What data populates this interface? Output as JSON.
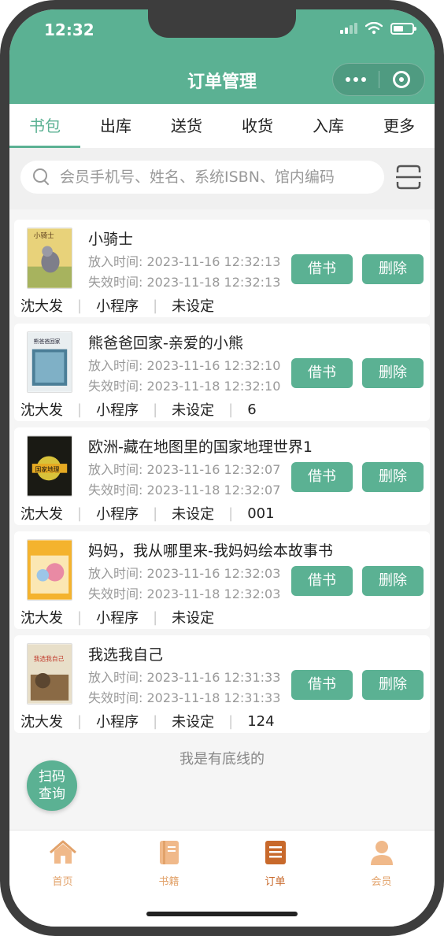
{
  "status": {
    "time": "12:32"
  },
  "header": {
    "title": "订单管理"
  },
  "tabs": [
    "书包",
    "出库",
    "送货",
    "收货",
    "入库",
    "更多"
  ],
  "search": {
    "placeholder": "会员手机号、姓名、系统ISBN、馆内编码"
  },
  "labels": {
    "borrow": "借书",
    "delete": "删除",
    "put_in_prefix": "放入时间: ",
    "expire_prefix": "失效时间: "
  },
  "orders": [
    {
      "title": "小骑士",
      "put_in": "放入时间: 2023-11-16 12:32:13",
      "expire": "失效时间: 2023-11-18 12:32:13",
      "member": "沈大发",
      "source": "小程序",
      "setting": "未设定",
      "extra": ""
    },
    {
      "title": "熊爸爸回家-亲爱的小熊",
      "put_in": "放入时间: 2023-11-16 12:32:10",
      "expire": "失效时间: 2023-11-18 12:32:10",
      "member": "沈大发",
      "source": "小程序",
      "setting": "未设定",
      "extra": "6"
    },
    {
      "title": "欧洲-藏在地图里的国家地理世界1",
      "put_in": "放入时间: 2023-11-16 12:32:07",
      "expire": "失效时间: 2023-11-18 12:32:07",
      "member": "沈大发",
      "source": "小程序",
      "setting": "未设定",
      "extra": "001"
    },
    {
      "title": "妈妈，我从哪里来-我妈妈绘本故事书",
      "put_in": "放入时间: 2023-11-16 12:32:03",
      "expire": "失效时间: 2023-11-18 12:32:03",
      "member": "沈大发",
      "source": "小程序",
      "setting": "未设定",
      "extra": ""
    },
    {
      "title": "我选我自己",
      "put_in": "放入时间: 2023-11-16 12:31:33",
      "expire": "失效时间: 2023-11-18 12:31:33",
      "member": "沈大发",
      "source": "小程序",
      "setting": "未设定",
      "extra": "124"
    }
  ],
  "list_end": "我是有底线的",
  "fab": {
    "line1": "扫码",
    "line2": "查询"
  },
  "nav": [
    {
      "label": "首页",
      "icon": "home-icon"
    },
    {
      "label": "书籍",
      "icon": "book-icon"
    },
    {
      "label": "订单",
      "icon": "order-icon"
    },
    {
      "label": "会员",
      "icon": "member-icon"
    }
  ],
  "colors": {
    "primary": "#5bb193",
    "nav_inactive": "#e2a26a",
    "nav_active": "#c8692b"
  }
}
